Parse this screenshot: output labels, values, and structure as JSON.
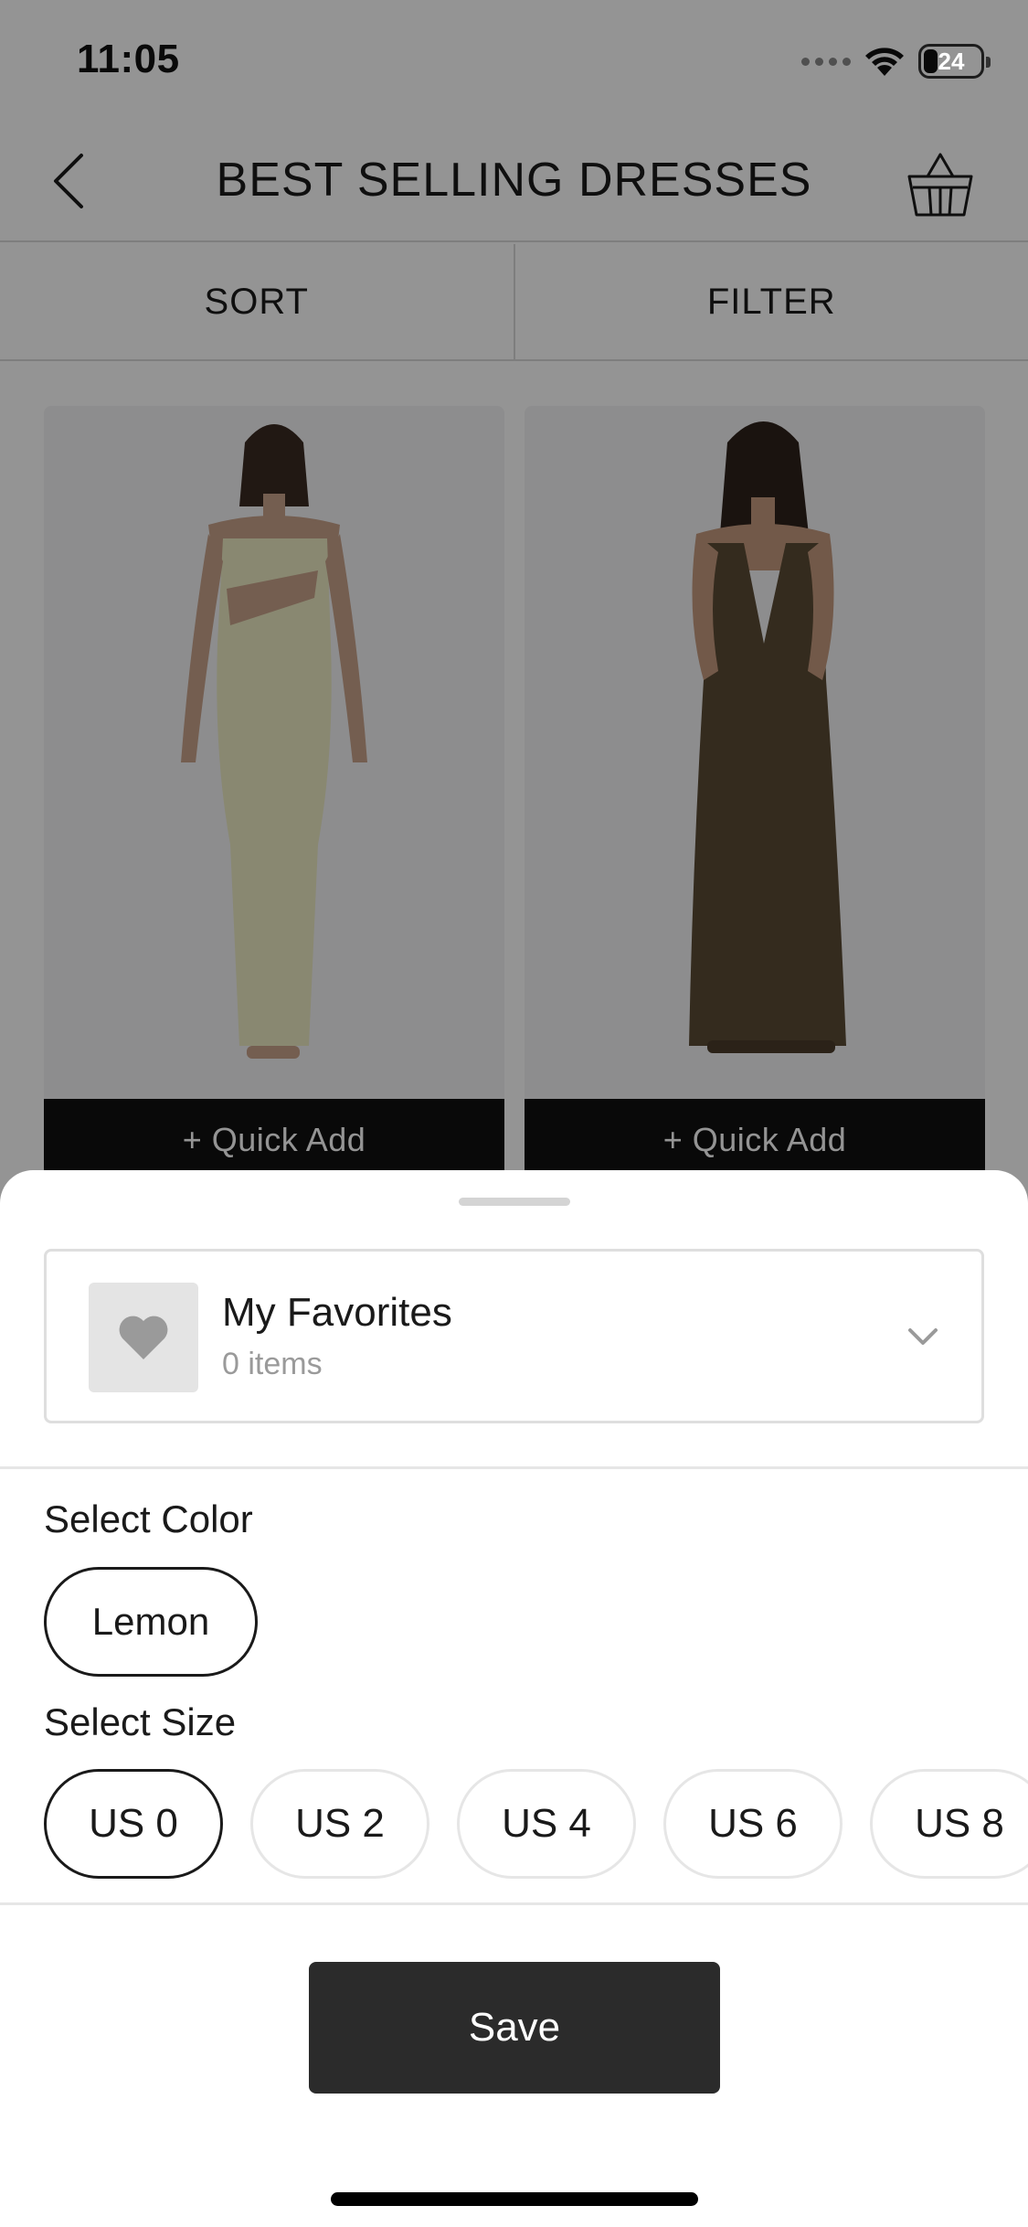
{
  "status_bar": {
    "time": "11:05",
    "battery": "24"
  },
  "header": {
    "title": "BEST SELLING DRESSES"
  },
  "toolbar": {
    "sort_label": "SORT",
    "filter_label": "FILTER"
  },
  "products": [
    {
      "dress_color": "#ecebc3",
      "quick_add_label": "+ Quick Add"
    },
    {
      "dress_color": "#5a4a34",
      "quick_add_label": "+ Quick Add"
    }
  ],
  "sheet": {
    "list": {
      "name": "My Favorites",
      "count": "0 items"
    },
    "color_section": {
      "label": "Select Color",
      "options": [
        "Lemon"
      ],
      "selected": "Lemon"
    },
    "size_section": {
      "label": "Select Size",
      "options": [
        "US 0",
        "US 2",
        "US 4",
        "US 6",
        "US 8"
      ],
      "selected": "US 0"
    },
    "save_label": "Save"
  },
  "colors": {
    "accent": "#2b2b2b",
    "border": "#e6e6e6",
    "muted_text": "#9a9a9a"
  }
}
